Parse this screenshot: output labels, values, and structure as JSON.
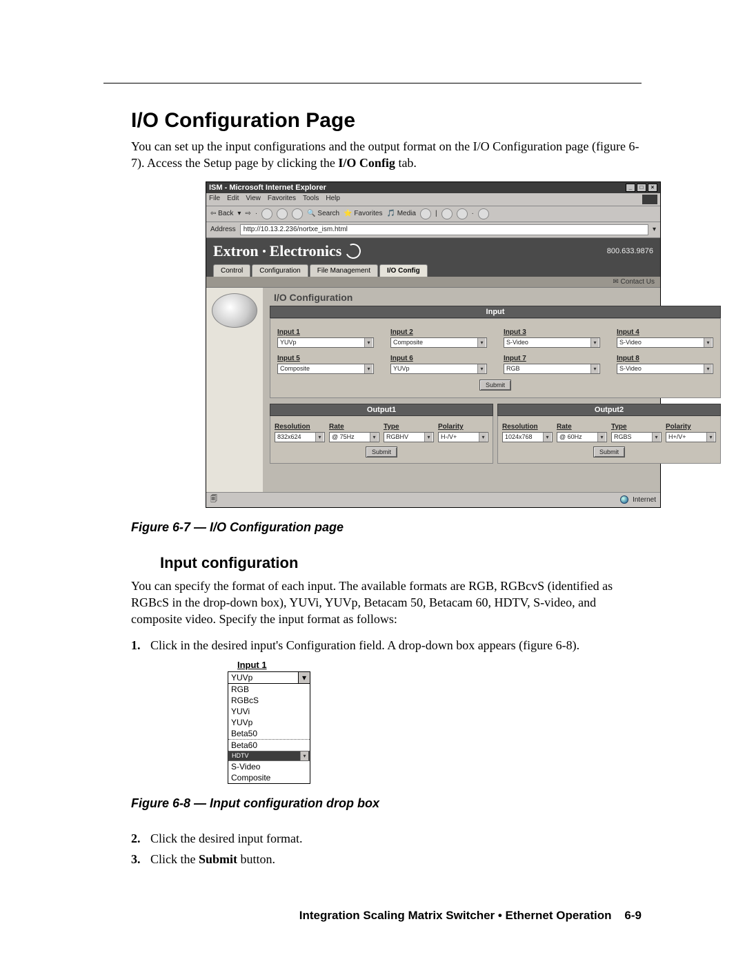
{
  "page": {
    "heading": "I/O Configuration Page",
    "intro_part1": "You can set up the input configurations and the output format on the I/O Configuration page (figure 6-7).  Access the Setup page by clicking the ",
    "intro_bold": "I/O Config",
    "intro_part2": " tab.",
    "figure67_caption": "Figure 6-7 — I/O Configuration page",
    "subhead": "Input configuration",
    "sub_intro": "You can specify the format of each input.  The available formats are RGB, RGBcvS (identified as RGBcS in the drop-down box), YUVi, YUVp, Betacam 50, Betacam 60, HDTV, S-video, and composite video.  Specify the input format as follows:",
    "step1": "Click in the desired input's Configuration field.  A drop-down box appears (figure 6-8).",
    "step2": "Click the desired input format.",
    "step3_a": "Click the ",
    "step3_bold": "Submit",
    "step3_b": " button.",
    "figure68_caption": "Figure 6-8 — Input configuration drop box",
    "footer_text": "Integration Scaling Matrix Switcher • Ethernet Operation",
    "footer_page": "6-9"
  },
  "browser": {
    "title": "ISM - Microsoft Internet Explorer",
    "menubar": [
      "File",
      "Edit",
      "View",
      "Favorites",
      "Tools",
      "Help"
    ],
    "toolbar": {
      "back": "Back",
      "search": "Search",
      "favorites": "Favorites",
      "media": "Media"
    },
    "address_label": "Address",
    "address_url": "http://10.13.2.236/nortxe_ism.html",
    "status_right": "Internet"
  },
  "site": {
    "brand": "Extron Electronics",
    "phone": "800.633.9876",
    "contact": "Contact Us",
    "tabs": [
      {
        "label": "Control",
        "active": false
      },
      {
        "label": "Configuration",
        "active": false
      },
      {
        "label": "File Management",
        "active": false
      },
      {
        "label": "I/O Config",
        "active": true
      }
    ]
  },
  "ioconfig": {
    "page_title": "I/O Configuration",
    "input_bar": "Input",
    "inputs": [
      {
        "label": "Input 1",
        "value": "YUVp"
      },
      {
        "label": "Input 2",
        "value": "Composite"
      },
      {
        "label": "Input 3",
        "value": "S-Video"
      },
      {
        "label": "Input 4",
        "value": "S-Video"
      },
      {
        "label": "Input 5",
        "value": "Composite"
      },
      {
        "label": "Input 6",
        "value": "YUVp"
      },
      {
        "label": "Input 7",
        "value": "RGB"
      },
      {
        "label": "Input 8",
        "value": "S-Video"
      }
    ],
    "submit": "Submit",
    "outputs": [
      {
        "bar": "Output1",
        "fields": {
          "Resolution": "832x624",
          "Rate": "@ 75Hz",
          "Type": "RGBHV",
          "Polarity": "H-/V+"
        }
      },
      {
        "bar": "Output2",
        "fields": {
          "Resolution": "1024x768",
          "Rate": "@ 60Hz",
          "Type": "RGBS",
          "Polarity": "H+/V+"
        }
      }
    ]
  },
  "dropdown": {
    "label": "Input 1",
    "value": "YUVp",
    "options": [
      "RGB",
      "RGBcS",
      "YUVi",
      "YUVp",
      "Beta50",
      "Beta60",
      "HDTV",
      "S-Video",
      "Composite"
    ],
    "selected_index": 6
  }
}
